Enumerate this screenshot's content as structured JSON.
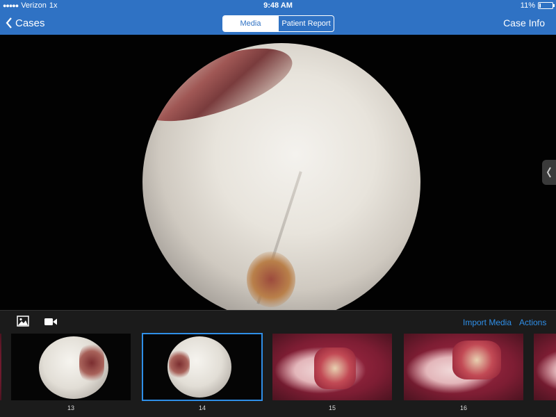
{
  "status_bar": {
    "signal": "●●●●●",
    "carrier": "Verizon",
    "speed": "1x",
    "time": "9:48 AM",
    "battery_percent": "11%",
    "battery_level": 0.11
  },
  "nav": {
    "back_label": "Cases",
    "tabs": [
      {
        "label": "Media",
        "selected": true
      },
      {
        "label": "Patient Report",
        "selected": false
      }
    ],
    "right_label": "Case Info"
  },
  "toolbar": {
    "photo_icon": "photo-icon",
    "video_icon": "video-camera-icon",
    "import_label": "Import Media",
    "actions_label": "Actions",
    "accent": "#2f8fe8"
  },
  "thumbnails": [
    {
      "label": "13",
      "kind": "arthroscopy"
    },
    {
      "label": "14",
      "kind": "arthroscopy",
      "selected": true
    },
    {
      "label": "15",
      "kind": "surgical"
    },
    {
      "label": "16",
      "kind": "surgical"
    },
    {
      "label": "",
      "kind": "surgical"
    }
  ],
  "colors": {
    "nav_blue": "#2f72c4",
    "link_blue": "#2f8fe8",
    "panel": "#1b1b1b"
  }
}
